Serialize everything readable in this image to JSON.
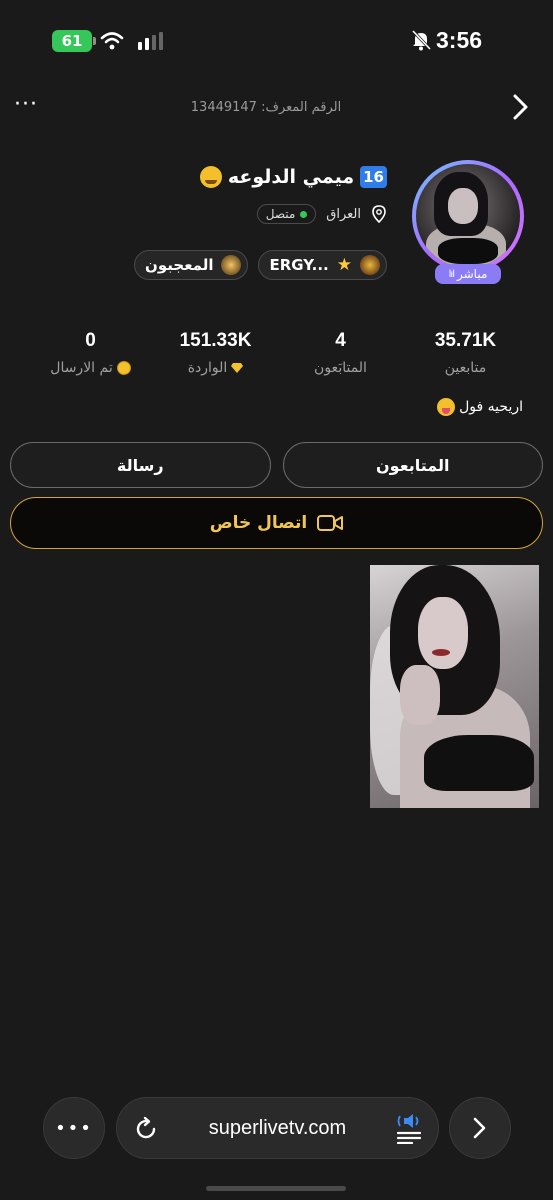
{
  "status_bar": {
    "battery": "61",
    "time": "3:56"
  },
  "header": {
    "more": "···",
    "user_id": "الرقم المعرف: 13449147"
  },
  "profile": {
    "level": "16",
    "name": "ميمي الدلوعه",
    "live_label": "مباشر",
    "live_bars": "lıl",
    "location": "العراق",
    "online_label": "متصل",
    "tags": [
      {
        "label": "ERGY...",
        "icon": "family-badge-icon"
      },
      {
        "label": "المعجبون",
        "icon": "fans-badge-icon"
      }
    ],
    "bio": "اريحيه فول"
  },
  "stats": [
    {
      "value": "35.71K",
      "label": "متابعين"
    },
    {
      "value": "4",
      "label": "المتابَعون"
    },
    {
      "value": "151.33K",
      "label": "الواردة"
    },
    {
      "value": "0",
      "label": "تم الارسال"
    }
  ],
  "actions": {
    "following": "المتابعون",
    "message": "رسالة",
    "private_call": "اتصال خاص"
  },
  "browser": {
    "url": "superlivetv.com",
    "more": "•••"
  },
  "colors": {
    "background": "#1a1a1a",
    "level_badge": "#2f7dea",
    "live_badge": "#8b7cf6",
    "call_gold": "#f0c55a",
    "online": "#35c759"
  }
}
